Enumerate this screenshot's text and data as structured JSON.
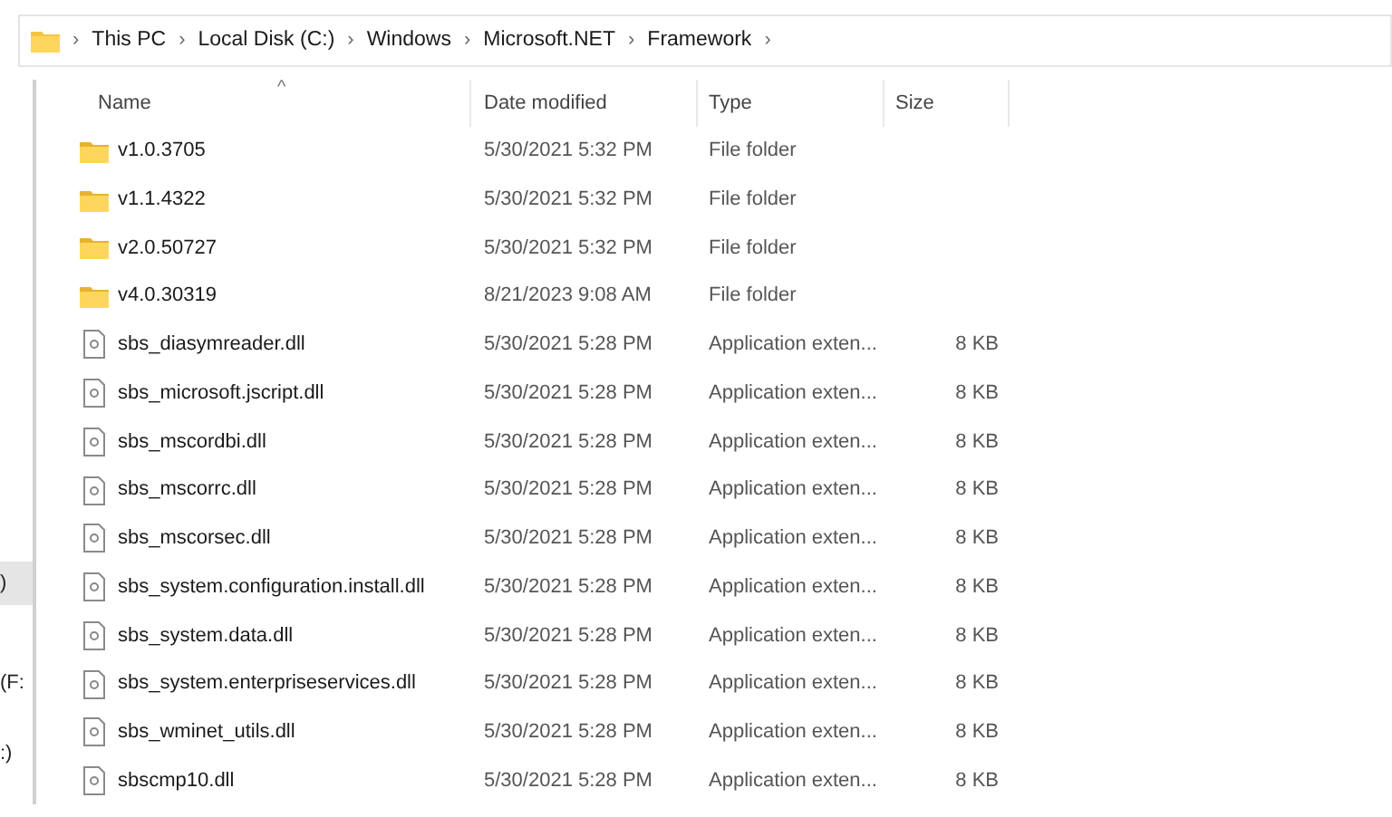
{
  "address_bar": {
    "path": [
      "This PC",
      "Local Disk (C:)",
      "Windows",
      "Microsoft.NET",
      "Framework"
    ],
    "separator": "›"
  },
  "sidebar": {
    "items": [
      {
        "label": ")",
        "selected": true
      },
      {
        "label": "(F:",
        "selected": false
      },
      {
        "label": ":)",
        "selected": false
      }
    ]
  },
  "file_list": {
    "sort_indicator": "^",
    "columns": [
      "Name",
      "Date modified",
      "Type",
      "Size"
    ],
    "rows": [
      {
        "kind": "folder",
        "name": "v1.0.3705",
        "date": "5/30/2021 5:32 PM",
        "type": "File folder"
      },
      {
        "kind": "folder",
        "name": "v1.1.4322",
        "date": "5/30/2021 5:32 PM",
        "type": "File folder"
      },
      {
        "kind": "folder",
        "name": "v2.0.50727",
        "date": "5/30/2021 5:32 PM",
        "type": "File folder"
      },
      {
        "kind": "folder",
        "name": "v4.0.30319",
        "date": "8/21/2023 9:08 AM",
        "type": "File folder"
      },
      {
        "kind": "file",
        "name": "sbs_diasymreader.dll",
        "date": "5/30/2021 5:28 PM",
        "type": "Application exten...",
        "size": "8 KB"
      },
      {
        "kind": "file",
        "name": "sbs_microsoft.jscript.dll",
        "date": "5/30/2021 5:28 PM",
        "type": "Application exten...",
        "size": "8 KB"
      },
      {
        "kind": "file",
        "name": "sbs_mscordbi.dll",
        "date": "5/30/2021 5:28 PM",
        "type": "Application exten...",
        "size": "8 KB"
      },
      {
        "kind": "file",
        "name": "sbs_mscorrc.dll",
        "date": "5/30/2021 5:28 PM",
        "type": "Application exten...",
        "size": "8 KB"
      },
      {
        "kind": "file",
        "name": "sbs_mscorsec.dll",
        "date": "5/30/2021 5:28 PM",
        "type": "Application exten...",
        "size": "8 KB"
      },
      {
        "kind": "file",
        "name": "sbs_system.configuration.install.dll",
        "date": "5/30/2021 5:28 PM",
        "type": "Application exten...",
        "size": "8 KB"
      },
      {
        "kind": "file",
        "name": "sbs_system.data.dll",
        "date": "5/30/2021 5:28 PM",
        "type": "Application exten...",
        "size": "8 KB"
      },
      {
        "kind": "file",
        "name": "sbs_system.enterpriseservices.dll",
        "date": "5/30/2021 5:28 PM",
        "type": "Application exten...",
        "size": "8 KB"
      },
      {
        "kind": "file",
        "name": "sbs_wminet_utils.dll",
        "date": "5/30/2021 5:28 PM",
        "type": "Application exten...",
        "size": "8 KB"
      },
      {
        "kind": "file",
        "name": "sbscmp10.dll",
        "date": "5/30/2021 5:28 PM",
        "type": "Application exten...",
        "size": "8 KB"
      }
    ]
  }
}
